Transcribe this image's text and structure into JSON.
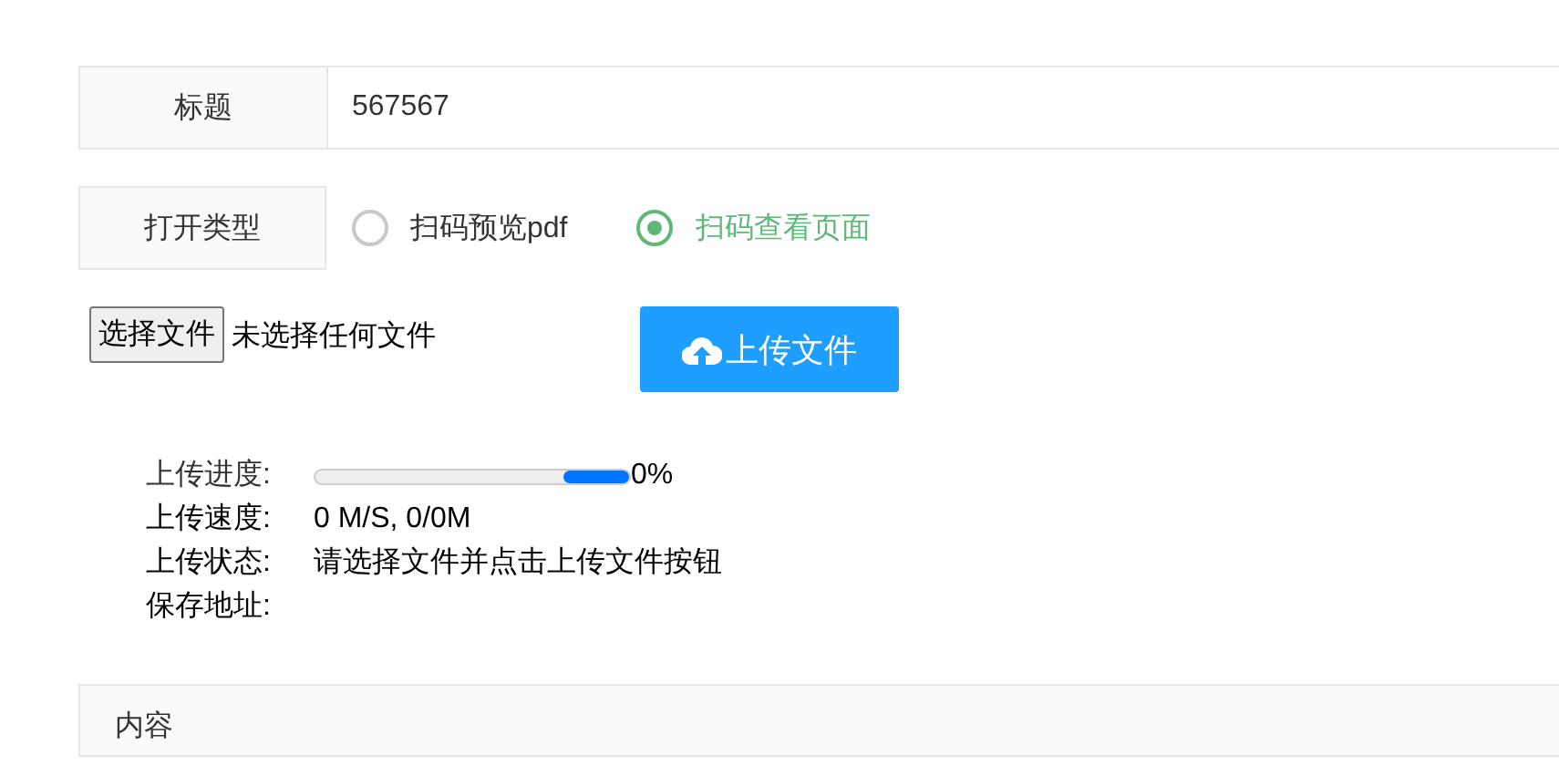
{
  "title_field": {
    "label": "标题",
    "value": "567567"
  },
  "open_type": {
    "label": "打开类型",
    "options": [
      {
        "label": "扫码预览pdf",
        "selected": false
      },
      {
        "label": "扫码查看页面",
        "selected": true
      }
    ]
  },
  "file_picker": {
    "button": "选择文件",
    "status": "未选择任何文件"
  },
  "upload_button": "上传文件",
  "progress": {
    "label": "上传进度:",
    "reading": "0%"
  },
  "info_rows": [
    {
      "label": "上传速度:",
      "value": "0 M/S, 0/0M"
    },
    {
      "label": "上传状态:",
      "value": "请选择文件并点击上传文件按钮"
    },
    {
      "label": "保存地址:"
    }
  ],
  "content_section": {
    "label": "内容"
  }
}
